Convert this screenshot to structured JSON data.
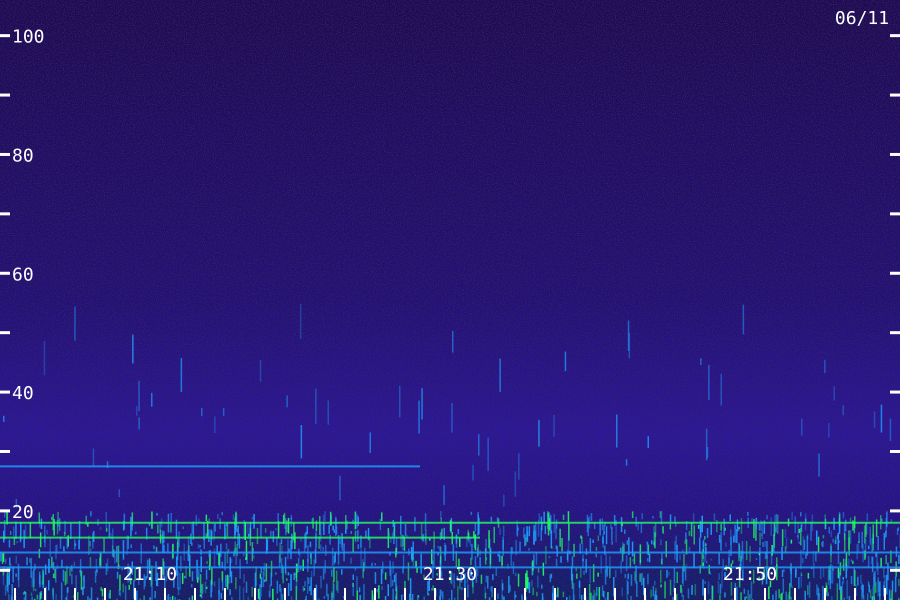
{
  "chart_data": {
    "type": "heatmap",
    "date_label": "06/11",
    "y_ticks": [
      {
        "value": 100,
        "label": "100"
      },
      {
        "value": 90,
        "label": ""
      },
      {
        "value": 80,
        "label": "80"
      },
      {
        "value": 70,
        "label": ""
      },
      {
        "value": 60,
        "label": "60"
      },
      {
        "value": 50,
        "label": ""
      },
      {
        "value": 40,
        "label": "40"
      },
      {
        "value": 30,
        "label": ""
      },
      {
        "value": 20,
        "label": "20"
      },
      {
        "value": 10,
        "label": ""
      }
    ],
    "ylim": [
      5,
      106
    ],
    "x_ticks": [
      {
        "value": "21:10",
        "label": "21:10"
      },
      {
        "value": "21:30",
        "label": "21:30"
      },
      {
        "value": "21:50",
        "label": "21:50"
      }
    ],
    "time_range": [
      "21:00",
      "22:00"
    ],
    "colors": {
      "background": "#200a5e",
      "noise_dark": "#0a0418",
      "mid": "#3a18b0",
      "high": "#1fa0ff",
      "peak": "#22ff66",
      "text": "#ffffff"
    }
  }
}
